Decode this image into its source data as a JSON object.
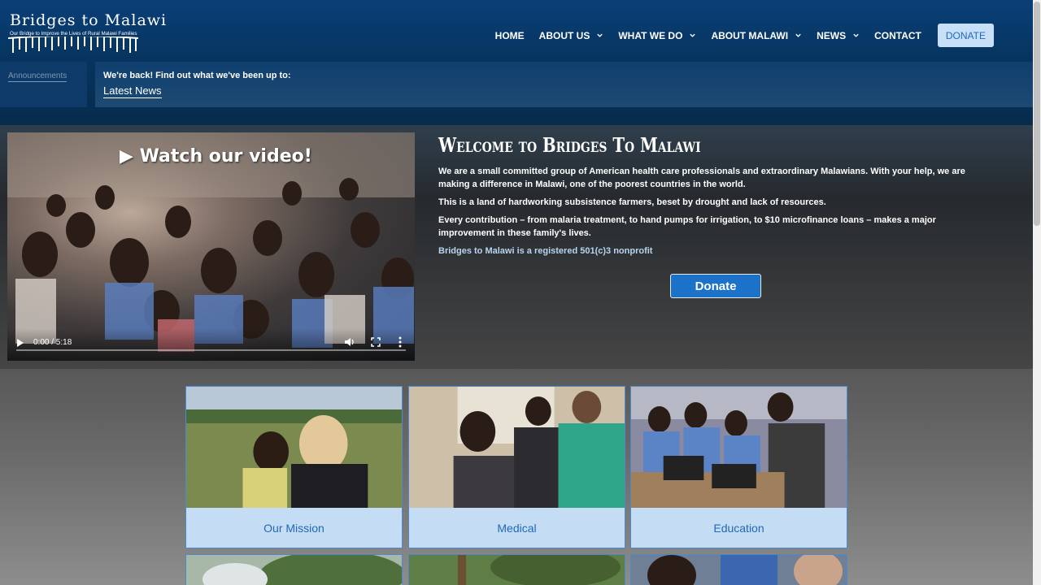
{
  "brand": {
    "logo_title": "Bridges to Malawi",
    "logo_tagline": "Our Bridge to Improve the Lives of Rural Malawi Families"
  },
  "nav": {
    "items": [
      {
        "label": "HOME",
        "dropdown": false
      },
      {
        "label": "ABOUT US",
        "dropdown": true
      },
      {
        "label": "WHAT WE DO",
        "dropdown": true
      },
      {
        "label": "ABOUT MALAWI",
        "dropdown": true
      },
      {
        "label": "NEWS",
        "dropdown": true
      },
      {
        "label": "CONTACT",
        "dropdown": false
      }
    ],
    "donate_label": "DONATE"
  },
  "announcement": {
    "label": "Announcements",
    "text": "We're back! Find out what we've been up to:",
    "link": "Latest News"
  },
  "video": {
    "overlay_title": "▶ Watch our video!",
    "time": "0:00 / 5:18"
  },
  "welcome": {
    "title": "Welcome to Bridges To Malawi",
    "p1": "We are a small committed group of American health care professionals and extraordinary Malawians. With your help, we are making a difference in Malawi, one of the poorest countries in the world.",
    "p2": "This is a land of hardworking subsistence farmers, beset by drought and lack of resources.",
    "p3": "Every contribution – from malaria treatment, to hand pumps for irrigation, to $10 microfinance loans – makes a major improvement in these family's lives.",
    "p4": "Bridges to Malawi is a registered 501(c)3 nonprofit",
    "donate_button": "Donate"
  },
  "cards": [
    {
      "label": "Our Mission"
    },
    {
      "label": "Medical"
    },
    {
      "label": "Education"
    }
  ],
  "colors": {
    "header_blue": "#06345f",
    "card_bg": "#c5dcf5",
    "card_text": "#2069b5",
    "donate_button": "#1c72c8"
  }
}
